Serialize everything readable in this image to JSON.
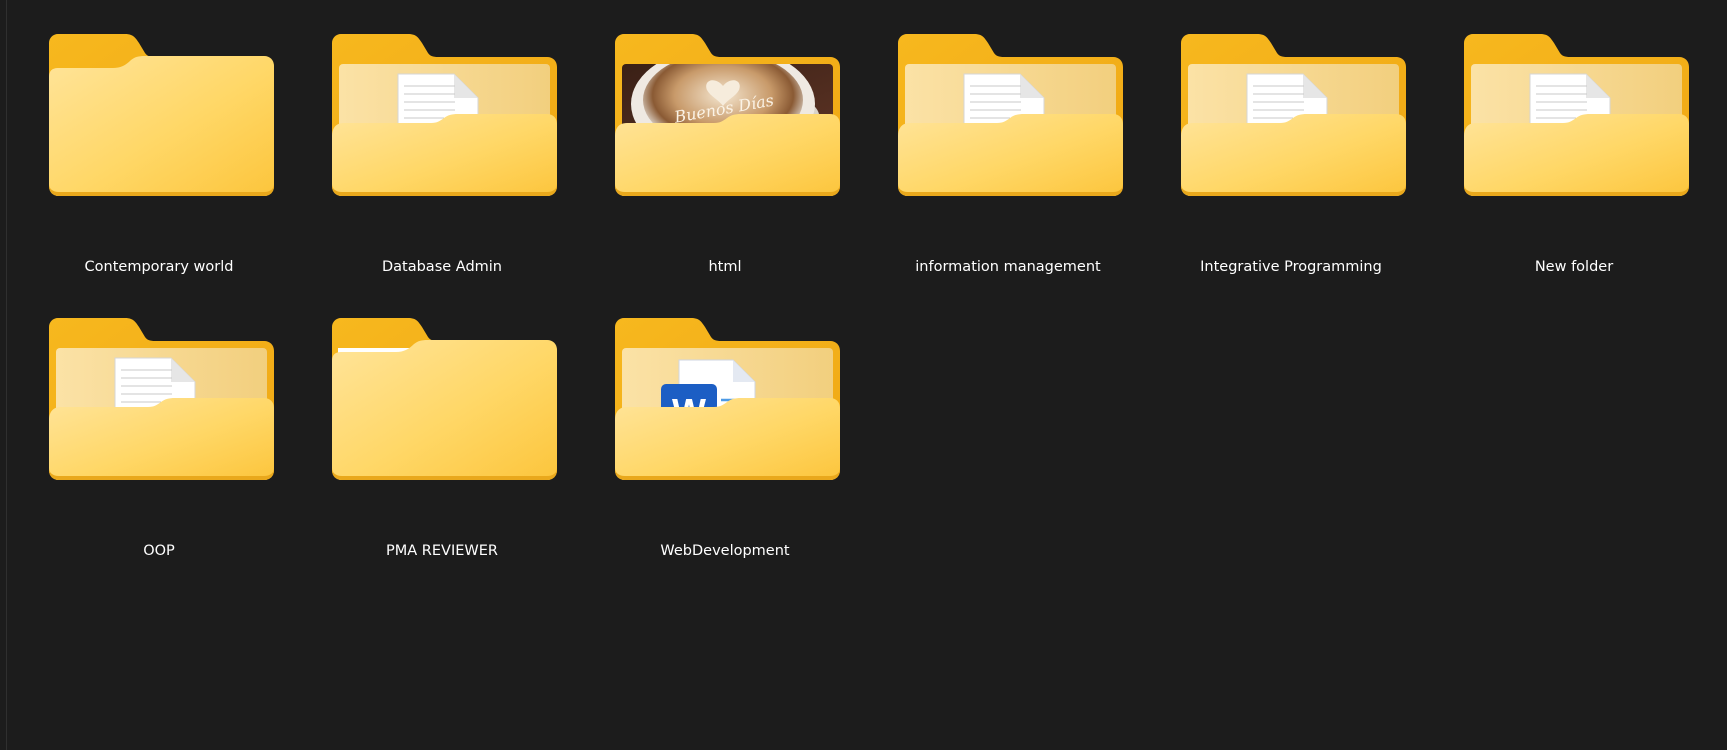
{
  "colors": {
    "background": "#1c1c1c",
    "folder_back": "#f2b21c",
    "folder_front": "#ffd666",
    "label_text": "#ffffff"
  },
  "folders": [
    {
      "name": "Contemporary world",
      "preview": "empty"
    },
    {
      "name": "Database Admin",
      "preview": "pdf-document"
    },
    {
      "name": "html",
      "preview": "photo",
      "photo_text": "Buenos Días"
    },
    {
      "name": "information management",
      "preview": "pdf-document"
    },
    {
      "name": "Integrative Programming",
      "preview": "pdf-document"
    },
    {
      "name": "New folder",
      "preview": "pdf-document"
    },
    {
      "name": "OOP",
      "preview": "pdf-document"
    },
    {
      "name": "PMA REVIEWER",
      "preview": "paper-sliver"
    },
    {
      "name": "WebDevelopment",
      "preview": "word-document",
      "word_letter": "W"
    }
  ]
}
